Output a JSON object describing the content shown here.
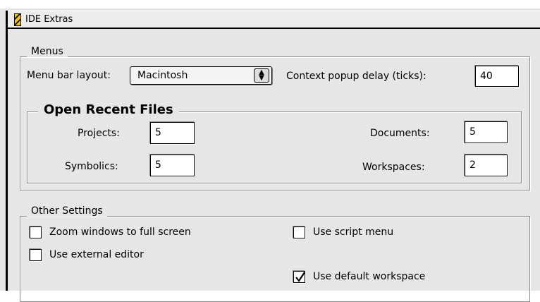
{
  "window": {
    "title": "IDE Extras",
    "title_icon": "app-icon"
  },
  "menus": {
    "group_label": "Menus",
    "menu_bar_layout_label": "Menu bar layout:",
    "menu_bar_layout_value": "Macintosh",
    "context_delay_label": "Context popup delay (ticks):",
    "context_delay_value": "40"
  },
  "open_recent": {
    "title": "Open Recent Files",
    "projects_label": "Projects:",
    "projects_value": "5",
    "symbolics_label": "Symbolics:",
    "symbolics_value": "5",
    "documents_label": "Documents:",
    "documents_value": "5",
    "workspaces_label": "Workspaces:",
    "workspaces_value": "2"
  },
  "other": {
    "group_label": "Other Settings",
    "zoom_label": "Zoom windows to full screen",
    "zoom_checked": false,
    "external_editor_label": "Use external editor",
    "external_editor_checked": false,
    "script_menu_label": "Use script menu",
    "script_menu_checked": false,
    "default_workspace_label": "Use default workspace",
    "default_workspace_checked": true
  }
}
